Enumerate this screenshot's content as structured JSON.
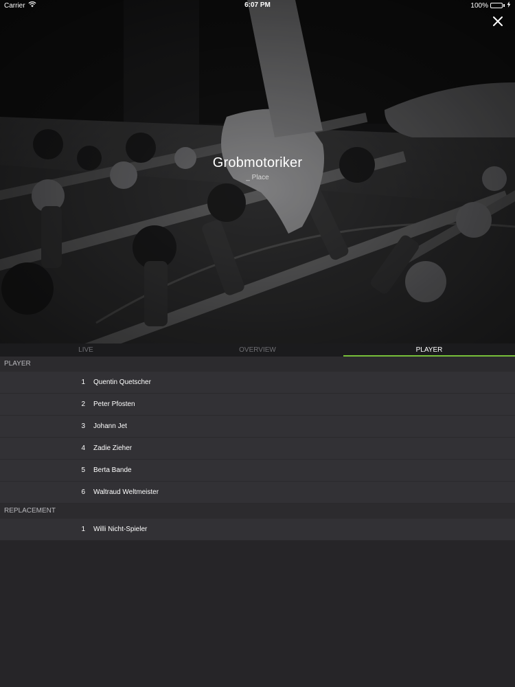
{
  "status_bar": {
    "carrier": "Carrier",
    "time": "6:07 PM",
    "battery": "100%",
    "battery_level": 1.0
  },
  "hero": {
    "team_name": "Grobmotoriker",
    "place": "_ Place",
    "close_icon": "close-icon"
  },
  "tabs": [
    {
      "label": "LIVE",
      "active": false
    },
    {
      "label": "OVERVIEW",
      "active": false
    },
    {
      "label": "PLAYER",
      "active": true
    }
  ],
  "colors": {
    "accent": "#78c03a",
    "background": "#262528",
    "row": "#323135"
  },
  "sections": {
    "players": {
      "title": "PLAYER",
      "rows": [
        {
          "number": "1",
          "name": "Quentin Quetscher"
        },
        {
          "number": "2",
          "name": "Peter Pfosten"
        },
        {
          "number": "3",
          "name": "Johann Jet"
        },
        {
          "number": "4",
          "name": "Zadie Zieher"
        },
        {
          "number": "5",
          "name": "Berta Bande"
        },
        {
          "number": "6",
          "name": "Waltraud Weltmeister"
        }
      ]
    },
    "replacements": {
      "title": "REPLACEMENT",
      "rows": [
        {
          "number": "1",
          "name": "Willi Nicht-Spieler"
        }
      ]
    }
  }
}
